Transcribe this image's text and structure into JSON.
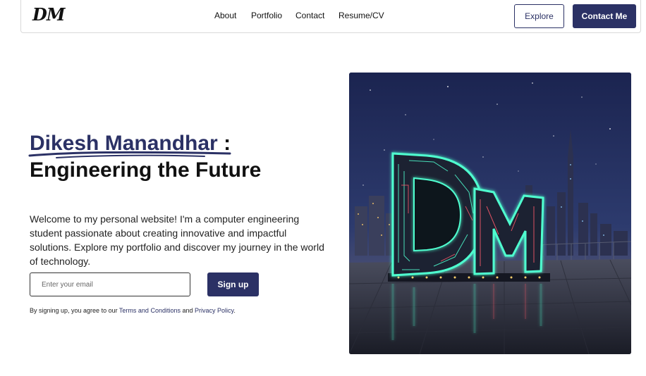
{
  "header": {
    "logo": "DM",
    "nav": [
      {
        "label": "About"
      },
      {
        "label": "Portfolio"
      },
      {
        "label": "Contact"
      },
      {
        "label": "Resume/CV"
      }
    ],
    "explore_label": "Explore",
    "contact_label": "Contact Me"
  },
  "hero": {
    "name": "Dikesh Manandhar",
    "separator": " :",
    "subtitle": "Engineering the Future",
    "description": "Welcome to my personal website! I'm a computer engineering student passionate about creating innovative and impactful solutions. Explore my portfolio and discover my journey in the world of technology.",
    "email_placeholder": "Enter your email",
    "signup_label": "Sign up",
    "terms_prefix": "By signing up, you agree to our ",
    "terms_link": "Terms and Conditions",
    "terms_and": " and ",
    "privacy_link": "Privacy Policy",
    "terms_suffix": ".",
    "image_letters": "DM"
  },
  "colors": {
    "primary": "#2b3165",
    "neon_green": "#4fffd0",
    "neon_red": "#ff5a6a"
  }
}
